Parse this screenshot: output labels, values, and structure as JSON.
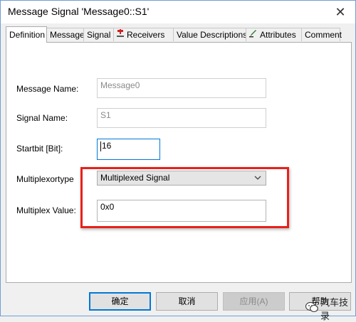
{
  "window": {
    "title": "Message Signal 'Message0::S1'",
    "close_label": "✕"
  },
  "tabs": [
    {
      "label": "Definition",
      "active": true
    },
    {
      "label": "Message"
    },
    {
      "label": "Signal"
    },
    {
      "label": "Receivers",
      "icon": "receivers-icon"
    },
    {
      "label": "Value Descriptions"
    },
    {
      "label": "Attributes",
      "icon": "attributes-icon"
    },
    {
      "label": "Comment"
    }
  ],
  "form": {
    "message_name_label": "Message Name:",
    "message_name_value": "Message0",
    "signal_name_label": "Signal Name:",
    "signal_name_value": "S1",
    "startbit_label": "Startbit [Bit]:",
    "startbit_value": "16",
    "multiplexortype_label": "Multiplexortype",
    "multiplexortype_value": "Multiplexed Signal",
    "multiplex_value_label": "Multiplex Value:",
    "multiplex_value_value": "0x0"
  },
  "buttons": {
    "ok": "确定",
    "cancel": "取消",
    "apply": "应用(A)",
    "help": "帮助"
  },
  "watermark": {
    "text": "汽车技录"
  },
  "colors": {
    "highlight": "#e8201a",
    "focus": "#0078d7",
    "window_border": "#6f9fd6"
  }
}
